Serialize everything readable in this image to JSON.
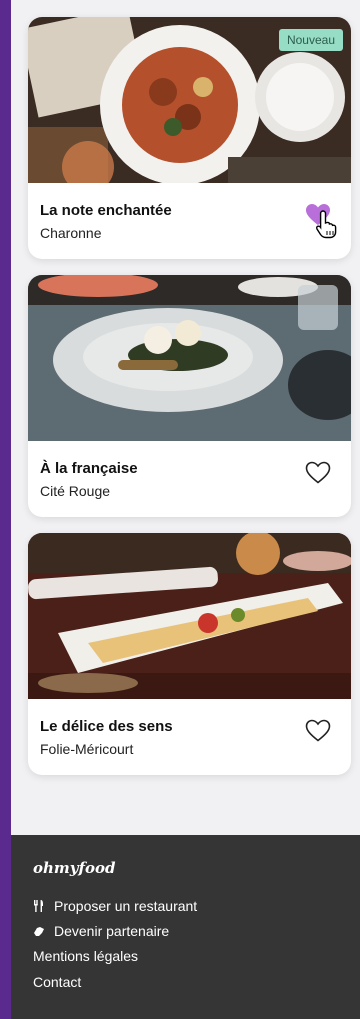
{
  "cards": [
    {
      "name": "La note enchantée",
      "location": "Charonne",
      "badge": "Nouveau",
      "favorite": true
    },
    {
      "name": "À la française",
      "location": "Cité Rouge",
      "favorite": false
    },
    {
      "name": "Le délice des sens",
      "location": "Folie-Méricourt",
      "favorite": false
    }
  ],
  "footer": {
    "logo": "ohmyfood",
    "links": [
      {
        "label": "Proposer un restaurant",
        "icon": "utensils-icon"
      },
      {
        "label": "Devenir partenaire",
        "icon": "handshake-icon"
      },
      {
        "label": "Mentions légales"
      },
      {
        "label": "Contact"
      }
    ]
  },
  "colors": {
    "page_bg": "#5b2a8f",
    "card_bg": "#ffffff",
    "badge_bg": "#97dcc5",
    "heart_active": "#b96fd9",
    "footer_bg": "#353535"
  }
}
